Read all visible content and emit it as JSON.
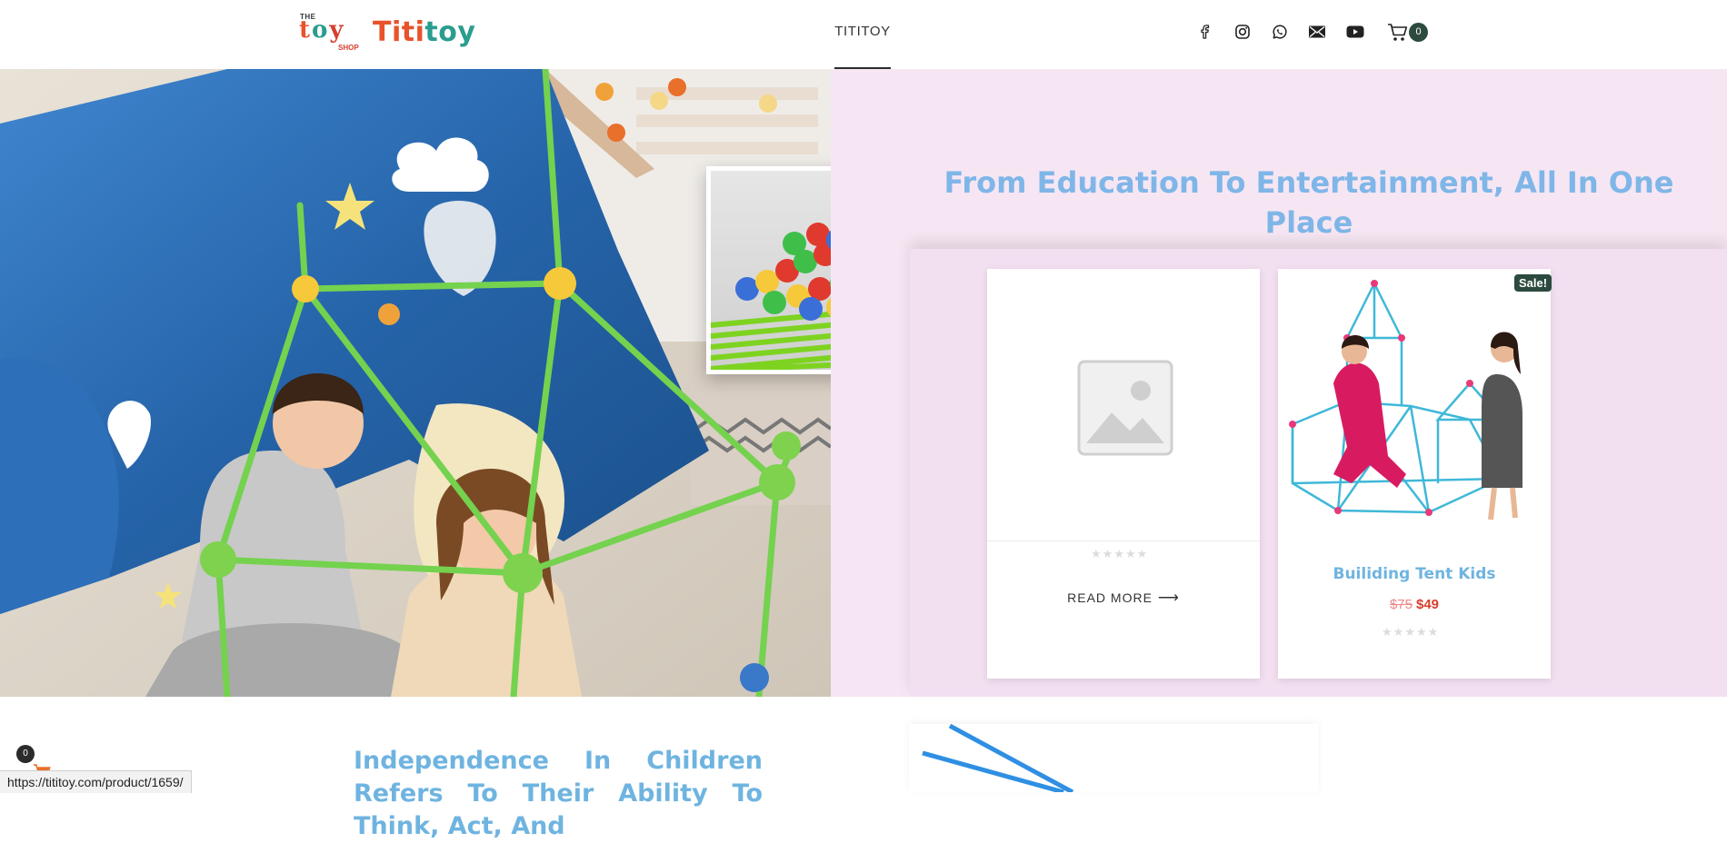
{
  "header": {
    "logo": {
      "the": "THE",
      "toy": [
        "t",
        "o",
        "y"
      ],
      "shop": "SHOP",
      "word_part1": "Titi",
      "word_part2": "toy"
    },
    "nav": [
      {
        "label": "TITITOY",
        "active": true
      }
    ],
    "social_icons": [
      "facebook-icon",
      "instagram-icon",
      "whatsapp-icon",
      "email-icon",
      "youtube-icon"
    ],
    "cart_count": "0"
  },
  "hero": {
    "headline": "From Education To Entertainment, All In One Place"
  },
  "products": [
    {
      "title": "",
      "rating": "0",
      "action_label": "READ MORE",
      "image": "placeholder-image"
    },
    {
      "title": "Builiding Tent Kids",
      "sale_badge": "Sale!",
      "old_price": "$75",
      "new_price": "$49",
      "rating": "0"
    }
  ],
  "below": {
    "text": "Independence In Children Refers To Their Ability To Think, Act, And"
  },
  "floating_cart": {
    "count": "0"
  },
  "status_bar": {
    "url": "https://tititoy.com/product/1659/"
  },
  "colors": {
    "accent_blue": "#7fb6e8",
    "pink_panel": "#f6e6f3",
    "badge_green": "#2d4a3e",
    "sale_red": "#d63e2e"
  }
}
